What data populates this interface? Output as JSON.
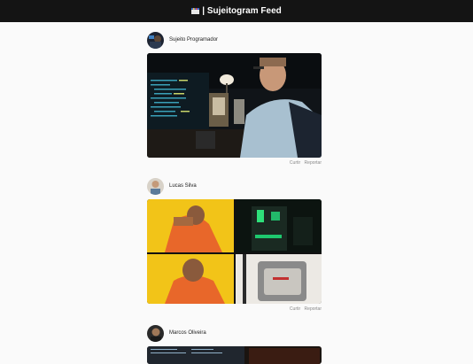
{
  "header": {
    "title": "| Sujeitogram Feed",
    "logo_icon": "film-clapper-icon"
  },
  "posts": [
    {
      "author": "Sujeito Programador",
      "like_label": "Curtir",
      "report_label": "Reportar"
    },
    {
      "author": "Lucas Silva",
      "like_label": "Curtir",
      "report_label": "Reportar"
    },
    {
      "author": "Marcos Oliveira"
    }
  ],
  "colors": {
    "header_bg": "#141414",
    "page_bg": "#fafafa",
    "muted_text": "#888888"
  }
}
